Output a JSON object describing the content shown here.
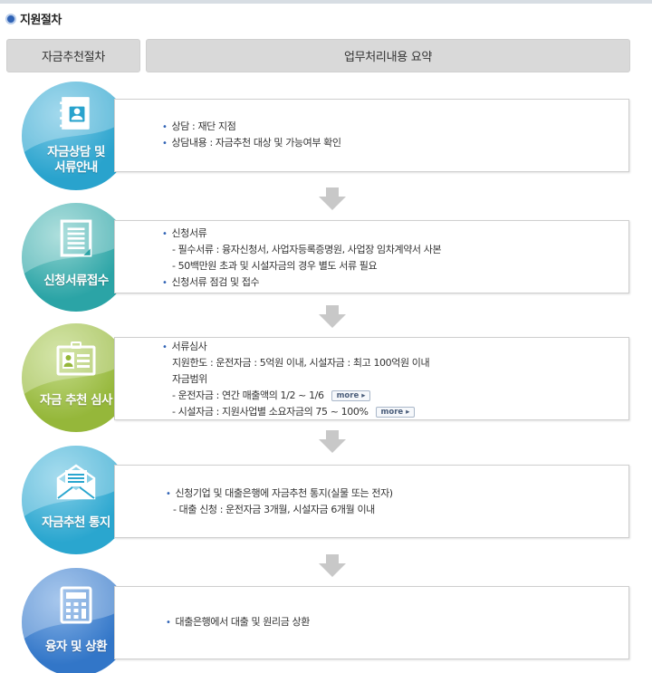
{
  "section": {
    "title": "지원절차"
  },
  "headers": {
    "left": "자금추천절차",
    "right": "업무처리내용 요약"
  },
  "more_label": "more",
  "steps": [
    {
      "label": [
        "자금상담 및",
        "서류안내"
      ],
      "icon": "consult-book-icon",
      "colors": {
        "main": "#29a3cd",
        "light": "#7fcae6"
      },
      "lines": [
        {
          "text": "상담 : 재단 지점",
          "bullet": true
        },
        {
          "text": "상담내용 : 자금추천 대상 및 가능여부 확인",
          "bullet": true
        }
      ]
    },
    {
      "label": [
        "신청서류접수"
      ],
      "icon": "document-list-icon",
      "colors": {
        "main": "#2ba4a6",
        "light": "#8fd3d0"
      },
      "lines": [
        {
          "text": "신청서류",
          "bullet": true
        },
        {
          "text": "- 필수서류 : 융자신청서, 사업자등록증명원, 사업장 임차계약서 사본"
        },
        {
          "text": "- 50백만원 초과 및 시설자금의 경우 별도 서류 필요"
        },
        {
          "text": "신청서류 점검 및 접수",
          "bullet": true
        }
      ]
    },
    {
      "label": [
        "자금 추천 심사"
      ],
      "icon": "id-card-icon",
      "colors": {
        "main": "#95b73a",
        "light": "#c5dc8a"
      },
      "lines": [
        {
          "text": "서류심사",
          "bullet": true
        },
        {
          "text": "지원한도 : 운전자금 : 5억원 이내, 시설자금 : 최고 100억원 이내"
        },
        {
          "text": "자금범위"
        },
        {
          "text": "- 운전자금 : 연간 매출액의 1/2 ~ 1/6",
          "more": true
        },
        {
          "text": "- 시설자금 : 지원사업별 소요자금의 75 ~ 100%",
          "more": true
        }
      ]
    },
    {
      "label": [
        "자금추천 통지"
      ],
      "icon": "envelope-icon",
      "colors": {
        "main": "#2aa6cf",
        "light": "#85cfe8"
      },
      "lines": [
        {
          "text": "신청기업 및 대출은행에 자금추천 통지(실물 또는 전자)",
          "bullet": true
        },
        {
          "text": "- 대출 신청 : 운전자금 3개월, 시설자금 6개월 이내"
        }
      ]
    },
    {
      "label": [
        "융자 및 상환"
      ],
      "icon": "calculator-icon",
      "colors": {
        "main": "#3276c8",
        "light": "#86b2e6"
      },
      "lines": [
        {
          "text": "대출은행에서 대출 및 원리금 상환",
          "bullet": true
        }
      ]
    }
  ]
}
